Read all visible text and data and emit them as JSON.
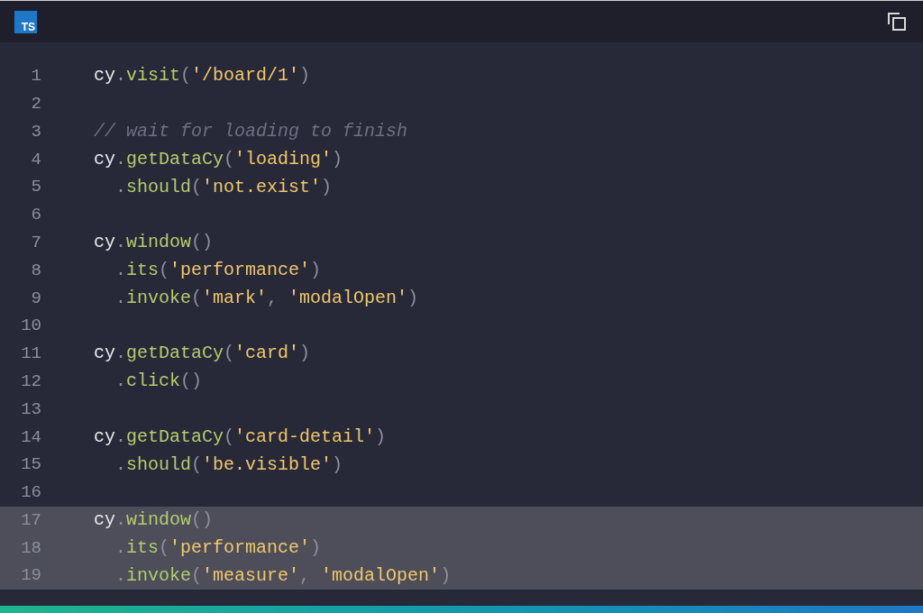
{
  "header": {
    "language_badge": "TS"
  },
  "lines": [
    {
      "number": "1",
      "highlighted": false,
      "tokens": [
        {
          "kind": "ident",
          "text": "cy"
        },
        {
          "kind": "punct",
          "text": "."
        },
        {
          "kind": "method",
          "text": "visit"
        },
        {
          "kind": "punct",
          "text": "("
        },
        {
          "kind": "string",
          "text": "'/board/1'"
        },
        {
          "kind": "punct",
          "text": ")"
        }
      ]
    },
    {
      "number": "2",
      "highlighted": false
    },
    {
      "number": "3",
      "highlighted": false,
      "tokens": [
        {
          "kind": "comment",
          "text": "// wait for loading to finish"
        }
      ]
    },
    {
      "number": "4",
      "highlighted": false,
      "tokens": [
        {
          "kind": "ident",
          "text": "cy"
        },
        {
          "kind": "punct",
          "text": "."
        },
        {
          "kind": "method",
          "text": "getDataCy"
        },
        {
          "kind": "punct",
          "text": "("
        },
        {
          "kind": "string",
          "text": "'loading'"
        },
        {
          "kind": "punct",
          "text": ")"
        }
      ]
    },
    {
      "number": "5",
      "highlighted": false,
      "tokens": [
        {
          "kind": "punct",
          "text": "  ."
        },
        {
          "kind": "method",
          "text": "should"
        },
        {
          "kind": "punct",
          "text": "("
        },
        {
          "kind": "string",
          "text": "'not.exist'"
        },
        {
          "kind": "punct",
          "text": ")"
        }
      ]
    },
    {
      "number": "6",
      "highlighted": false
    },
    {
      "number": "7",
      "highlighted": false,
      "tokens": [
        {
          "kind": "ident",
          "text": "cy"
        },
        {
          "kind": "punct",
          "text": "."
        },
        {
          "kind": "method",
          "text": "window"
        },
        {
          "kind": "punct",
          "text": "()"
        }
      ]
    },
    {
      "number": "8",
      "highlighted": false,
      "tokens": [
        {
          "kind": "punct",
          "text": "  ."
        },
        {
          "kind": "method",
          "text": "its"
        },
        {
          "kind": "punct",
          "text": "("
        },
        {
          "kind": "string",
          "text": "'performance'"
        },
        {
          "kind": "punct",
          "text": ")"
        }
      ]
    },
    {
      "number": "9",
      "highlighted": false,
      "tokens": [
        {
          "kind": "punct",
          "text": "  ."
        },
        {
          "kind": "method",
          "text": "invoke"
        },
        {
          "kind": "punct",
          "text": "("
        },
        {
          "kind": "string",
          "text": "'mark'"
        },
        {
          "kind": "punct",
          "text": ", "
        },
        {
          "kind": "string",
          "text": "'modalOpen'"
        },
        {
          "kind": "punct",
          "text": ")"
        }
      ]
    },
    {
      "number": "10",
      "highlighted": false
    },
    {
      "number": "11",
      "highlighted": false,
      "tokens": [
        {
          "kind": "ident",
          "text": "cy"
        },
        {
          "kind": "punct",
          "text": "."
        },
        {
          "kind": "method",
          "text": "getDataCy"
        },
        {
          "kind": "punct",
          "text": "("
        },
        {
          "kind": "string",
          "text": "'card'"
        },
        {
          "kind": "punct",
          "text": ")"
        }
      ]
    },
    {
      "number": "12",
      "highlighted": false,
      "tokens": [
        {
          "kind": "punct",
          "text": "  ."
        },
        {
          "kind": "method",
          "text": "click"
        },
        {
          "kind": "punct",
          "text": "()"
        }
      ]
    },
    {
      "number": "13",
      "highlighted": false
    },
    {
      "number": "14",
      "highlighted": false,
      "tokens": [
        {
          "kind": "ident",
          "text": "cy"
        },
        {
          "kind": "punct",
          "text": "."
        },
        {
          "kind": "method",
          "text": "getDataCy"
        },
        {
          "kind": "punct",
          "text": "("
        },
        {
          "kind": "string",
          "text": "'card-detail'"
        },
        {
          "kind": "punct",
          "text": ")"
        }
      ]
    },
    {
      "number": "15",
      "highlighted": false,
      "tokens": [
        {
          "kind": "punct",
          "text": "  ."
        },
        {
          "kind": "method",
          "text": "should"
        },
        {
          "kind": "punct",
          "text": "("
        },
        {
          "kind": "string",
          "text": "'be.visible'"
        },
        {
          "kind": "punct",
          "text": ")"
        }
      ]
    },
    {
      "number": "16",
      "highlighted": false
    },
    {
      "number": "17",
      "highlighted": true,
      "tokens": [
        {
          "kind": "ident",
          "text": "cy"
        },
        {
          "kind": "punct",
          "text": "."
        },
        {
          "kind": "method",
          "text": "window"
        },
        {
          "kind": "punct",
          "text": "()"
        }
      ]
    },
    {
      "number": "18",
      "highlighted": true,
      "tokens": [
        {
          "kind": "punct",
          "text": "  ."
        },
        {
          "kind": "method",
          "text": "its"
        },
        {
          "kind": "punct",
          "text": "("
        },
        {
          "kind": "string",
          "text": "'performance'"
        },
        {
          "kind": "punct",
          "text": ")"
        }
      ]
    },
    {
      "number": "19",
      "highlighted": true,
      "tokens": [
        {
          "kind": "punct",
          "text": "  ."
        },
        {
          "kind": "method",
          "text": "invoke"
        },
        {
          "kind": "punct",
          "text": "("
        },
        {
          "kind": "string",
          "text": "'measure'"
        },
        {
          "kind": "punct",
          "text": ", "
        },
        {
          "kind": "string",
          "text": "'modalOpen'"
        },
        {
          "kind": "punct",
          "text": ")"
        }
      ]
    }
  ]
}
